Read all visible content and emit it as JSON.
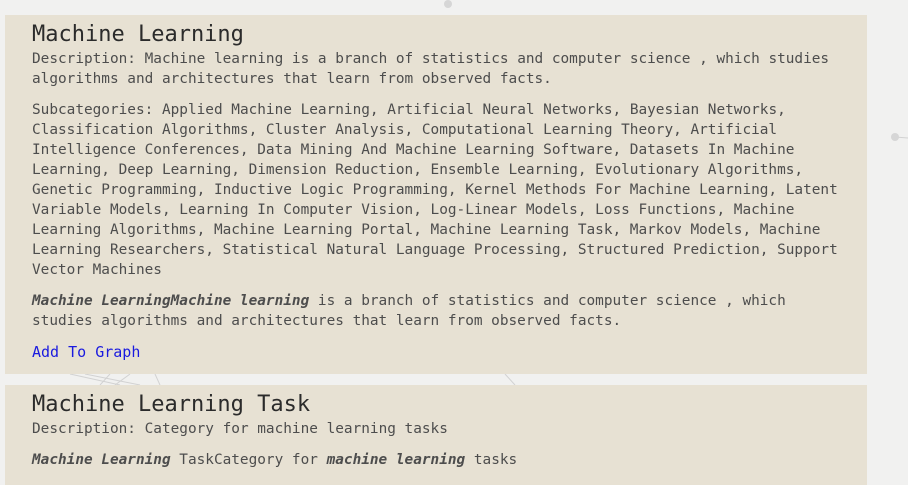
{
  "results": [
    {
      "title": "Machine Learning",
      "description_label": "Description:",
      "description": "Machine learning is a branch of statistics and computer science , which studies algorithms and architectures that learn from observed facts.",
      "subcategories_label": "Subcategories:",
      "subcategories": "Applied Machine Learning, Artificial Neural Networks, Bayesian Networks, Classification Algorithms, Cluster Analysis, Computational Learning Theory, Artificial Intelligence Conferences, Data Mining And Machine Learning Software, Datasets In Machine Learning, Deep Learning, Dimension Reduction, Ensemble Learning, Evolutionary Algorithms, Genetic Programming, Inductive Logic Programming, Kernel Methods For Machine Learning, Latent Variable Models, Learning In Computer Vision, Log-Linear Models, Loss Functions, Machine Learning Algorithms, Machine Learning Portal, Machine Learning Task, Markov Models, Machine Learning Researchers, Statistical Natural Language Processing, Structured Prediction, Support Vector Machines",
      "snippet_em": "Machine LearningMachine learning",
      "snippet_rest": " is a branch of statistics and computer science , which studies algorithms and architectures that learn from observed facts.",
      "link": "Add To Graph"
    },
    {
      "title": "Machine Learning Task",
      "description_label": "Description:",
      "description": "Category for machine learning tasks",
      "snippet_em1": "Machine Learning",
      "snippet_mid": " TaskCategory for ",
      "snippet_em2": "machine learning",
      "snippet_end": " tasks"
    }
  ]
}
